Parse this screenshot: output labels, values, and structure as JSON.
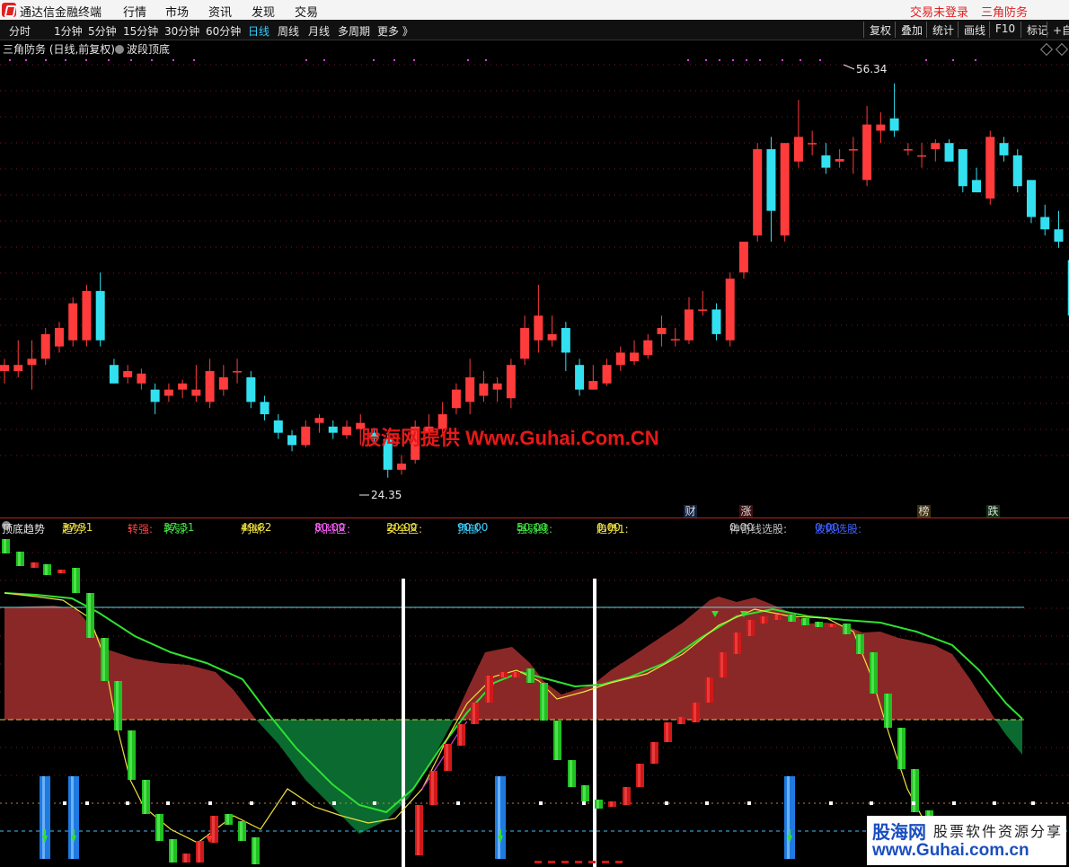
{
  "app": {
    "title": "通达信金融终端",
    "menus": [
      "行情",
      "市场",
      "资讯",
      "发现",
      "交易"
    ],
    "login_status": "交易未登录",
    "user_label": "三角防务"
  },
  "toolbar": {
    "periods": [
      "分时",
      "1分钟",
      "5分钟",
      "15分钟",
      "30分钟",
      "60分钟",
      "日线",
      "周线",
      "月线",
      "多周期",
      "更多 》"
    ],
    "active_period": "日线",
    "right_buttons": [
      "复权",
      "叠加",
      "统计",
      "画线",
      "F10",
      "标记",
      "+自"
    ]
  },
  "chart_title": {
    "stock": "三角防务 (日线,前复权)",
    "indicator": "波段顶底"
  },
  "price_chart": {
    "high_label": "56.34",
    "low_label": "24.35",
    "tags": [
      {
        "text": "财",
        "color": "#3cf"
      },
      {
        "text": "涨",
        "color": "#ff5050"
      },
      {
        "text": "榜",
        "color": "#f0a050"
      },
      {
        "text": "跌",
        "color": "#50e050"
      }
    ],
    "up_color": "#ff3b3b",
    "down_color": "#33e0f0"
  },
  "indicator_bar": {
    "name": "顶底趋势",
    "fields": [
      {
        "label": "趋势: ",
        "value": "37.31",
        "color": "#f0e040"
      },
      {
        "label": "转强: ",
        "value": "-",
        "color": "#ff4040"
      },
      {
        "label": "转弱: ",
        "value": "37.31",
        "color": "#40e040"
      },
      {
        "label": "判断: ",
        "value": "49.82",
        "color": "#f0e040"
      },
      {
        "label": "风险区: ",
        "value": "80.00",
        "color": "#ff60ff"
      },
      {
        "label": "安全区: ",
        "value": "20.00",
        "color": "#f0e040"
      },
      {
        "label": "顶部: ",
        "value": "90.00",
        "color": "#40d0ff"
      },
      {
        "label": "强弱线: ",
        "value": "50.00",
        "color": "#40e040"
      },
      {
        "label": "趋势1: ",
        "value": "0.00",
        "color": "#f0e040"
      },
      {
        "label": "神奇线选股: ",
        "value": "0.00",
        "color": "#c0c0c0"
      },
      {
        "label": "波段选股: ",
        "value": "0.00",
        "color": "#4060ff"
      }
    ]
  },
  "watermark": "股海网提供 Www.Guhai.Com.CN",
  "corner_badge": {
    "brand": "股海网",
    "slogan": "股票软件资源分享",
    "url": "www.Guhai.com.cn"
  },
  "chart_data": {
    "type": "candlestick",
    "y_range": [
      22,
      58
    ],
    "candles": [
      [
        33.0,
        33.5,
        32.0,
        34.0
      ],
      [
        33.0,
        33.5,
        32.5,
        35.5
      ],
      [
        33.5,
        34.0,
        31.5,
        35.5
      ],
      [
        34.0,
        36.0,
        33.5,
        36.5
      ],
      [
        35.0,
        36.5,
        34.5,
        37.0
      ],
      [
        35.5,
        38.5,
        35.0,
        39.0
      ],
      [
        35.5,
        39.5,
        35.0,
        40.0
      ],
      [
        39.5,
        35.5,
        35.0,
        41.0
      ],
      [
        33.5,
        32.0,
        32.0,
        34.0
      ],
      [
        32.5,
        33.0,
        32.0,
        33.5
      ],
      [
        32.0,
        32.8,
        31.5,
        33.2
      ],
      [
        31.5,
        30.5,
        29.5,
        32.0
      ],
      [
        31.0,
        31.5,
        30.5,
        32.0
      ],
      [
        31.5,
        32.0,
        30.8,
        32.3
      ],
      [
        31.0,
        31.5,
        30.5,
        33.5
      ],
      [
        30.5,
        33.0,
        30.0,
        34.0
      ],
      [
        31.5,
        32.5,
        31.0,
        33.5
      ],
      [
        33.0,
        33.0,
        32.0,
        34.0
      ],
      [
        32.5,
        30.5,
        30.0,
        33.0
      ],
      [
        30.5,
        29.5,
        29.0,
        31.0
      ],
      [
        29.0,
        28.0,
        27.5,
        29.5
      ],
      [
        27.8,
        27.0,
        26.5,
        28.2
      ],
      [
        27.0,
        28.5,
        26.8,
        29.0
      ],
      [
        28.8,
        29.2,
        28.0,
        29.5
      ],
      [
        28.5,
        28.0,
        27.5,
        29.0
      ],
      [
        27.8,
        28.5,
        27.5,
        29.0
      ],
      [
        28.3,
        28.8,
        27.0,
        29.5
      ],
      [
        28.0,
        27.5,
        27.2,
        28.4
      ],
      [
        27.5,
        25.0,
        24.35,
        27.8
      ],
      [
        25.0,
        25.5,
        24.6,
        26.2
      ],
      [
        25.8,
        28.5,
        25.5,
        29.0
      ],
      [
        28.0,
        28.5,
        27.5,
        29.5
      ],
      [
        28.3,
        29.5,
        27.8,
        30.5
      ],
      [
        30.0,
        31.5,
        29.5,
        32.0
      ],
      [
        30.5,
        32.5,
        29.5,
        34.0
      ],
      [
        31.0,
        32.0,
        30.5,
        33.0
      ],
      [
        31.5,
        32.0,
        30.5,
        32.5
      ],
      [
        30.8,
        33.5,
        30.0,
        34.0
      ],
      [
        34.0,
        36.5,
        33.5,
        37.5
      ],
      [
        35.5,
        37.5,
        34.5,
        40.0
      ],
      [
        35.5,
        36.0,
        35.0,
        37.5
      ],
      [
        36.5,
        34.5,
        33.0,
        37.0
      ],
      [
        33.5,
        31.5,
        31.0,
        34.0
      ],
      [
        31.5,
        32.2,
        31.5,
        33.5
      ],
      [
        32.0,
        33.5,
        31.8,
        34.0
      ],
      [
        33.5,
        34.5,
        33.0,
        35.0
      ],
      [
        33.8,
        34.5,
        33.5,
        35.5
      ],
      [
        34.3,
        35.5,
        34.0,
        36.0
      ],
      [
        36.0,
        36.5,
        35.0,
        37.5
      ],
      [
        35.5,
        35.6,
        35.0,
        36.5
      ],
      [
        35.5,
        38.0,
        35.2,
        39.0
      ],
      [
        38.0,
        38.0,
        37.5,
        39.5
      ],
      [
        38.0,
        36.0,
        35.5,
        38.5
      ],
      [
        35.5,
        40.5,
        35.0,
        41.0
      ],
      [
        41.0,
        43.5,
        40.5,
        43.5
      ],
      [
        44.0,
        51.0,
        43.5,
        51.5
      ],
      [
        51.0,
        46.0,
        43.5,
        52.0
      ],
      [
        44.0,
        51.5,
        43.5,
        51.5
      ],
      [
        50.0,
        52.0,
        49.5,
        55.0
      ],
      [
        51.5,
        51.5,
        50.5,
        52.5
      ],
      [
        50.5,
        49.5,
        49.0,
        51.5
      ],
      [
        50.0,
        50.2,
        49.5,
        51.0
      ],
      [
        51.0,
        51.0,
        49.0,
        52.0
      ],
      [
        48.5,
        53.0,
        48.0,
        54.5
      ],
      [
        52.5,
        53.0,
        51.5,
        54.0
      ],
      [
        53.5,
        52.5,
        52.0,
        56.34
      ],
      [
        51.0,
        51.0,
        50.5,
        51.5
      ],
      [
        50.5,
        50.5,
        49.5,
        51.5
      ],
      [
        51.0,
        51.5,
        50.0,
        51.8
      ],
      [
        51.5,
        50.0,
        50.0,
        51.8
      ],
      [
        51.0,
        48.0,
        47.5,
        51.0
      ],
      [
        48.5,
        47.5,
        47.5,
        49.5
      ],
      [
        47.0,
        52.0,
        46.5,
        52.5
      ],
      [
        51.5,
        50.5,
        50.0,
        52.0
      ],
      [
        50.5,
        48.0,
        47.5,
        51.0
      ],
      [
        48.5,
        45.5,
        45.0,
        48.5
      ],
      [
        45.5,
        44.5,
        44.0,
        46.5
      ],
      [
        44.5,
        43.5,
        43.0,
        46.0
      ],
      [
        42.0,
        37.5,
        37.5,
        42.0
      ],
      [
        37.0,
        38.0,
        36.5,
        38.5
      ],
      [
        37.0,
        37.8,
        35.5,
        38.0
      ]
    ]
  }
}
